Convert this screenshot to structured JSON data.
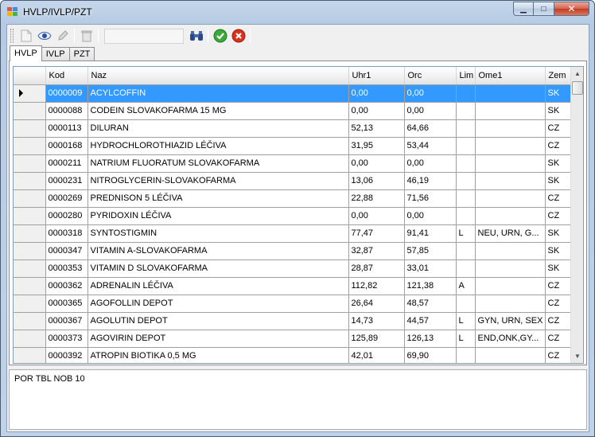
{
  "window": {
    "title": "HVLP/IVLP/PZT"
  },
  "icons": {
    "new": "new-document-icon",
    "view": "eye-icon",
    "edit": "pencil-icon",
    "delete": "trash-icon",
    "find": "binoculars-icon",
    "confirm": "green-check-icon",
    "cancel": "red-x-icon"
  },
  "colors": {
    "selection": "#3399ff",
    "confirm": "#3aa93a",
    "cancel": "#d9321e"
  },
  "search": {
    "value": ""
  },
  "tabs": [
    {
      "label": "HVLP",
      "active": true
    },
    {
      "label": "IVLP",
      "active": false
    },
    {
      "label": "PZT",
      "active": false
    }
  ],
  "grid": {
    "columns": [
      "Kod",
      "Naz",
      "Uhr1",
      "Orc",
      "Lim",
      "Ome1",
      "Zem"
    ],
    "rows": [
      [
        "0000009",
        "ACYLCOFFIN",
        "0,00",
        "0,00",
        "",
        "",
        "SK"
      ],
      [
        "0000088",
        "CODEIN SLOVAKOFARMA 15 MG",
        "0,00",
        "0,00",
        "",
        "",
        "SK"
      ],
      [
        "0000113",
        "DILURAN",
        "52,13",
        "64,66",
        "",
        "",
        "CZ"
      ],
      [
        "0000168",
        "HYDROCHLOROTHIAZID LÉČIVA",
        "31,95",
        "53,44",
        "",
        "",
        "CZ"
      ],
      [
        "0000211",
        "NATRIUM FLUORATUM SLOVAKOFARMA",
        "0,00",
        "0,00",
        "",
        "",
        "SK"
      ],
      [
        "0000231",
        "NITROGLYCERIN-SLOVAKOFARMA",
        "13,06",
        "46,19",
        "",
        "",
        "SK"
      ],
      [
        "0000269",
        "PREDNISON 5 LÉČIVA",
        "22,88",
        "71,56",
        "",
        "",
        "CZ"
      ],
      [
        "0000280",
        "PYRIDOXIN LÉČIVA",
        "0,00",
        "0,00",
        "",
        "",
        "CZ"
      ],
      [
        "0000318",
        "SYNTOSTIGMIN",
        "77,47",
        "91,41",
        "L",
        "NEU, URN, G...",
        "SK"
      ],
      [
        "0000347",
        "VITAMIN A-SLOVAKOFARMA",
        "32,87",
        "57,85",
        "",
        "",
        "SK"
      ],
      [
        "0000353",
        "VITAMIN D SLOVAKOFARMA",
        "28,87",
        "33,01",
        "",
        "",
        "SK"
      ],
      [
        "0000362",
        "ADRENALIN LÉČIVA",
        "112,82",
        "121,38",
        "A",
        "",
        "CZ"
      ],
      [
        "0000365",
        "AGOFOLLIN DEPOT",
        "26,64",
        "48,57",
        "",
        "",
        "CZ"
      ],
      [
        "0000367",
        "AGOLUTIN DEPOT",
        "14,73",
        "44,57",
        "L",
        "GYN, URN, SEX",
        "CZ"
      ],
      [
        "0000373",
        "AGOVIRIN DEPOT",
        "125,89",
        "126,13",
        "L",
        "END,ONK,GY...",
        "CZ"
      ],
      [
        "0000392",
        "ATROPIN BIOTIKA 0,5 MG",
        "42,01",
        "69,90",
        "",
        "",
        "CZ"
      ]
    ],
    "selected_row": 0
  },
  "notes": {
    "text": "POR TBL NOB 10"
  }
}
